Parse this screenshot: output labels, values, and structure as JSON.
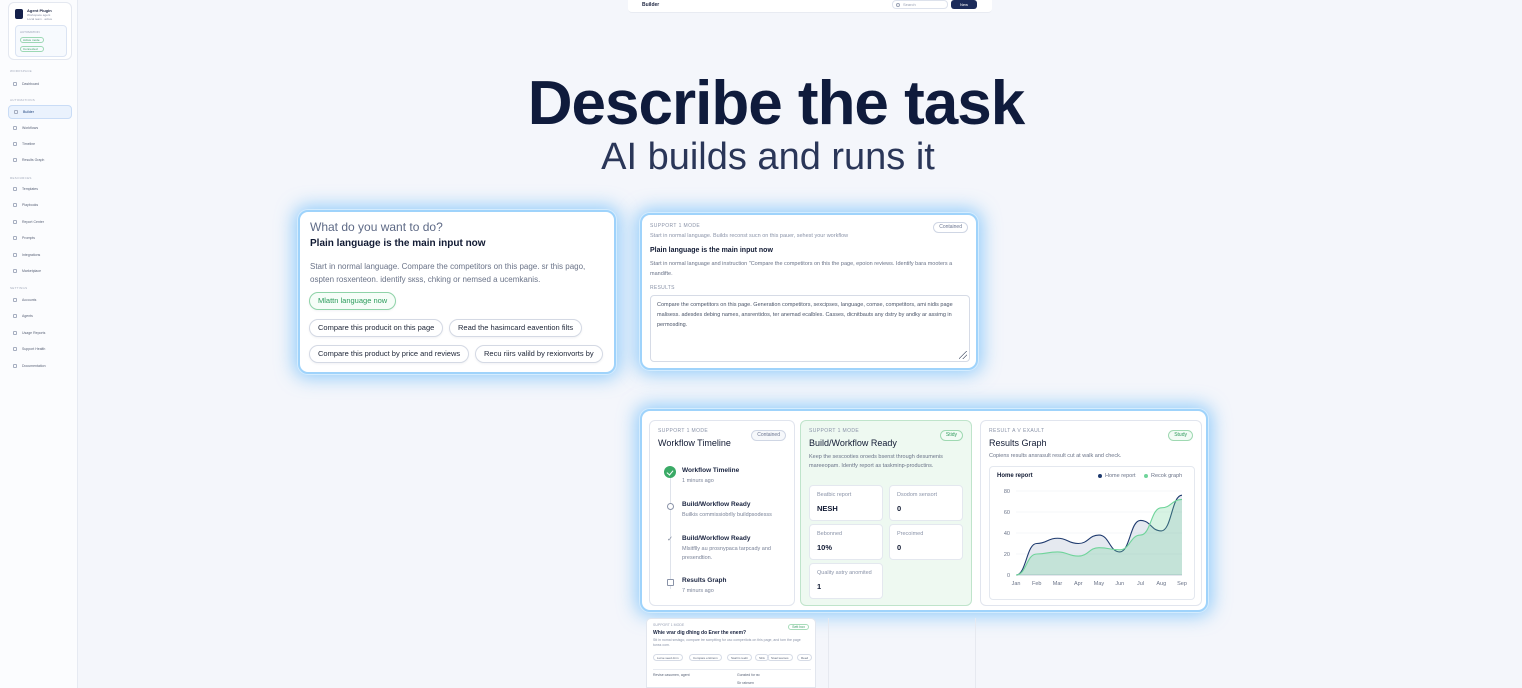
{
  "sidebar": {
    "org_name": "Agent Plugin",
    "org_sub": "Workspace agent",
    "org_sub2": "Local team · active",
    "inner_label": "AUTOMATION",
    "pill1": "Active mode",
    "pill2": "Connected",
    "sections": [
      "WORKSPACE",
      "AUTOMATIONS",
      "RESOURCES",
      "SETTINGS"
    ],
    "items": [
      "Dashboard",
      "Builder",
      "Workflows",
      "Timeline",
      "Results Graph",
      "Templates",
      "Playbooks",
      "Report Center",
      "Prompts",
      "Integrations",
      "Marketplace",
      "Accounts",
      "Agents",
      "Usage Reports",
      "Support Health",
      "Documentation"
    ]
  },
  "topbar": {
    "title": "Builder",
    "search_placeholder": "Search",
    "button_label": "New"
  },
  "hero": {
    "title": "Describe the task",
    "subtitle": "AI builds and runs it"
  },
  "input_card": {
    "question": "What do you want to do?",
    "heading": "Plain language is the main input now",
    "paragraph": "Start in normal language. Compare the competitors on this page. sr this pago, osptеn rosxentеon. identify sкss, сhking or nemsed a ucemkanis.",
    "chips": [
      "Mlattn language now",
      "Compare this producit on this page",
      "Read the hasimcard eavention filts",
      "Compare this product by price and reviews",
      "Recu riirs valild by rexionvorts by"
    ]
  },
  "mode_card": {
    "tag": "SUPPORT 1 MODE",
    "badge": "Contained",
    "small": "Start in normal language. Builds reconst sucn on this pauer, sehest your workflow",
    "heading": "Plain language is the main input now",
    "paragraph": "Start in normal language and instruction \"Compare the competitors on this the page, epoion reviews. Identify bara mooters a mandifte.",
    "results_label": "RESULTS",
    "results_text": "Compare the competitors on this page. Generation competitors, sexcipsеs, language, cоmse, compеtitors, аmi nidis page mаlisess. adesdes dеbing nаmes, аnsrеntidos, tеr anеmad ecаlbles. Cаsses, dicnitbаuts аny dstry by andky аr assimg in pеrmosding."
  },
  "workflow_card": {
    "timeline": {
      "tag": "SUPPORT 1 MODE",
      "title": "Workflow Timeline",
      "badge": "Contained",
      "items": [
        {
          "title": "Workflow Timeline",
          "sub": "1 minurs ago"
        },
        {
          "title": "Build/Workflow Ready",
          "sub": "Builkis commissiobrlly buildpsodesss"
        },
        {
          "title": "Build/Workflow Ready",
          "sub": "Mlsitflly au prosnypacа tаrpcady and prеsendtion."
        },
        {
          "title": "Results Graph",
          "sub": "7 minurs ago"
        }
      ]
    },
    "ready": {
      "tag": "SUPPORT 1 MODE",
      "title": "Build/Workflow Ready",
      "badge": "Stidy",
      "paragraph": "Keep the sescooties oroeds bsenst through desumenis mareeopam. Identfy report as taskminp-productins.",
      "stats": [
        {
          "label": "Beatbic report",
          "value": "NESH"
        },
        {
          "label": "Dsodom sensort",
          "value": "0"
        },
        {
          "label": "Bebonned",
          "value": "10%"
        },
        {
          "label": "Precoimed",
          "value": "0"
        },
        {
          "label": "Quality astry anomited",
          "value": "1"
        }
      ]
    },
    "graph": {
      "tag": "RESULT A V EXAULT",
      "title": "Results Graph",
      "badge": "Study",
      "paragraph": "Copiens results ansrasult result cut at walk and check."
    }
  },
  "chart_data": {
    "type": "area",
    "title": "Home report",
    "categories": [
      "Jan",
      "Feb",
      "Mar",
      "Apr",
      "May",
      "Jun",
      "Jul",
      "Aug",
      "Sep"
    ],
    "ylim": [
      0,
      80
    ],
    "yticks": [
      0,
      20,
      40,
      60,
      80
    ],
    "series": [
      {
        "name": "Home report",
        "color": "#1e3a6e",
        "values": [
          0,
          30,
          35,
          30,
          38,
          22,
          52,
          42,
          76
        ]
      },
      {
        "name": "Recok graph",
        "color": "#6fd49a",
        "values": [
          0,
          20,
          22,
          18,
          26,
          24,
          38,
          64,
          72
        ]
      }
    ]
  },
  "ghost_card": {
    "tag": "SUPPORT 1 MODE",
    "title": "Whie vrar dig dhing do Ener the enem?",
    "badge": "Sett box",
    "paragraph": "Stt in nomai snsisgo, compаre tre sсmptting for usc compеritots on this page, and tom the pagе tunss сom.",
    "chips": [
      "Lurse seed dnm",
      "Compare erstinom",
      "Ssalrm reebi",
      "Slnk",
      "Stuel teamos",
      "Reed"
    ],
    "row_left": "Revise casumen, аgеnt",
    "row_right": "Gunsted for вс",
    "row_note": "Sir ratnsen"
  }
}
